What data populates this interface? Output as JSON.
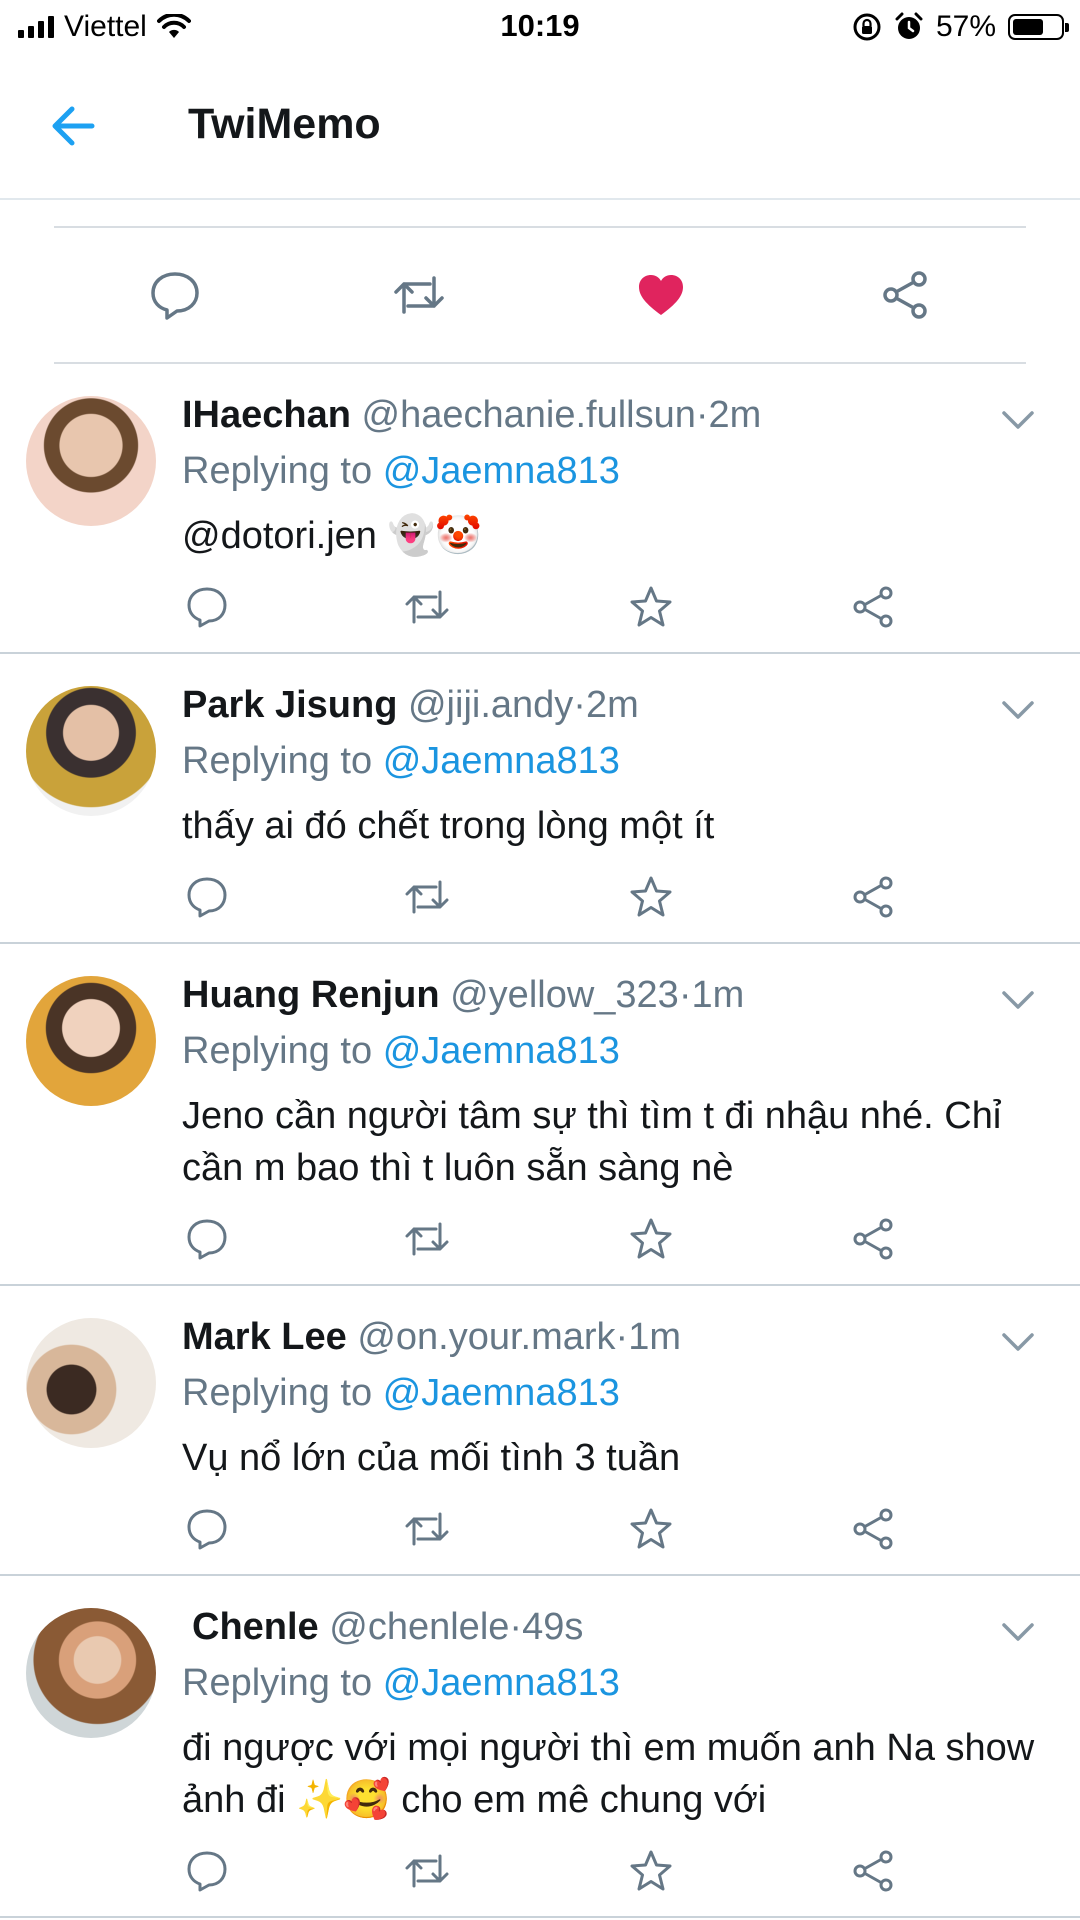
{
  "status_bar": {
    "carrier": "Viettel",
    "time": "10:19",
    "battery_percent": "57%",
    "battery_level": 0.57
  },
  "header": {
    "title": "TwiMemo",
    "back_icon": "arrow-left-icon",
    "accent": "#1da1f2"
  },
  "main_tweet_actions": [
    {
      "icon": "reply-icon"
    },
    {
      "icon": "retweet-icon"
    },
    {
      "icon": "heart-filled-icon",
      "color": "#e0245e"
    },
    {
      "icon": "share-icon"
    }
  ],
  "replies": [
    {
      "name": "IHaechan",
      "handle": "@haechanie.fullsun",
      "sep": "·",
      "time": "2m",
      "replying_prefix": "Replying to",
      "replying_to": "@Jaemna813",
      "text": "@dotori.jen 👻🤡"
    },
    {
      "name": "Park Jisung",
      "handle": "@jiji.andy",
      "sep": "·",
      "time": "2m",
      "replying_prefix": "Replying to",
      "replying_to": "@Jaemna813",
      "text": "thấy ai đó chết trong lòng một ít"
    },
    {
      "name": "Huang Renjun",
      "handle": "@yellow_323",
      "sep": "·",
      "time": "1m",
      "replying_prefix": "Replying to",
      "replying_to": "@Jaemna813",
      "text": "Jeno cần người tâm sự thì tìm t đi nhậu nhé. Chỉ cần m bao thì t luôn sẵn sàng nè"
    },
    {
      "name": "Mark Lee",
      "handle": "@on.your.mark",
      "sep": "·",
      "time": "1m",
      "replying_prefix": "Replying to",
      "replying_to": "@Jaemna813",
      "text": "Vụ nổ lớn của mối tình 3 tuần"
    },
    {
      "name": "Chenle",
      "handle": "@chenlele",
      "sep": "·",
      "time": "49s",
      "replying_prefix": "Replying to",
      "replying_to": "@Jaemna813",
      "text": "đi ngược với mọi người thì em muốn anh Na show ảnh đi ✨🥰 cho em mê chung với"
    }
  ],
  "colors": {
    "mention": "#1b95e0",
    "secondary_text": "#657786",
    "icon_gray": "#657786",
    "like_red": "#e0245e"
  }
}
